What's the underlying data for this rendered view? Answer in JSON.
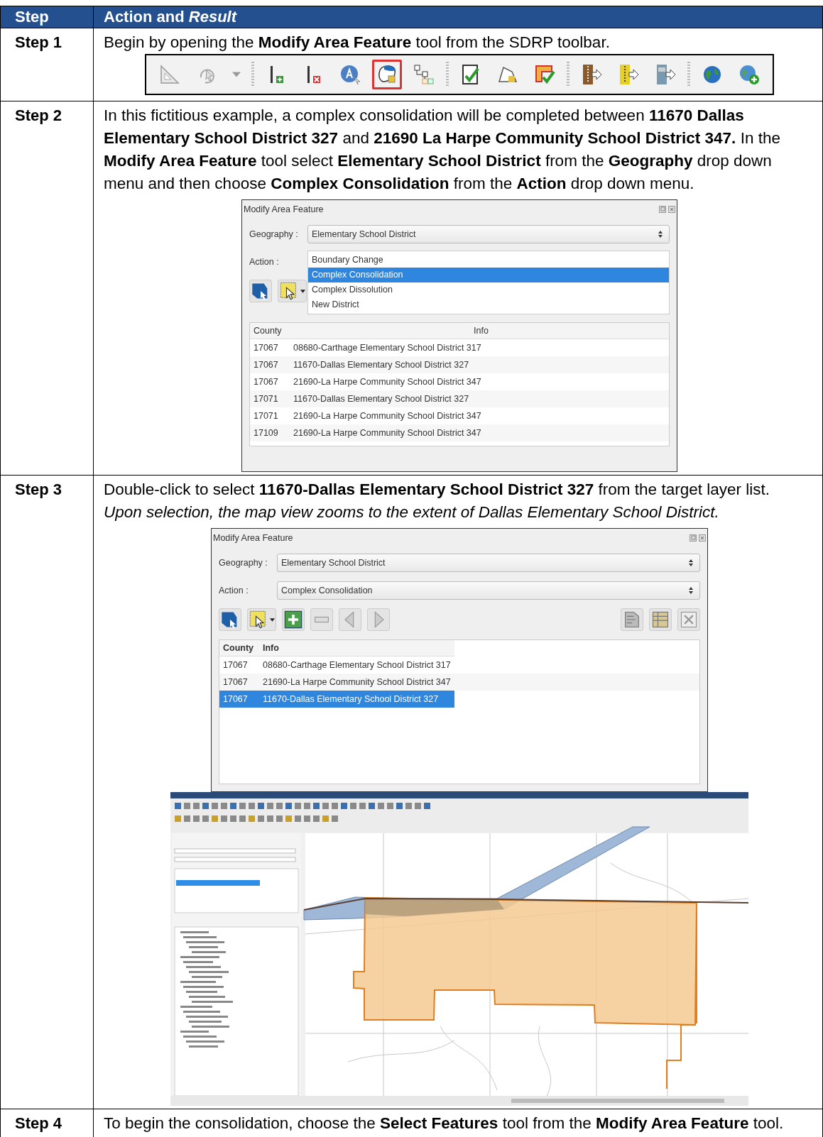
{
  "table": {
    "columns": [
      "Step",
      "Action and *Result*"
    ],
    "rows": [
      {
        "step": "Step 1",
        "text": "Begin by opening the **Modify Area Feature** tool from the SDRP toolbar.",
        "toolbar": {
          "groups": [
            [
              {
                "kind": "ruler",
                "highlighted": false
              },
              {
                "kind": "rotate",
                "highlighted": false
              },
              {
                "kind": "caret",
                "highlighted": false
              }
            ],
            [
              {
                "kind": "add-line",
                "highlighted": false
              },
              {
                "kind": "delete-line",
                "highlighted": false
              },
              {
                "kind": "label",
                "highlighted": false
              },
              {
                "kind": "area-edit",
                "highlighted": true
              },
              {
                "kind": "tree",
                "highlighted": false
              }
            ],
            [
              {
                "kind": "check-doc",
                "highlighted": false
              },
              {
                "kind": "polygon-edit",
                "highlighted": false
              },
              {
                "kind": "polygon-check",
                "highlighted": false
              }
            ],
            [
              {
                "kind": "export-zip",
                "highlighted": false
              },
              {
                "kind": "export-folder",
                "highlighted": false
              },
              {
                "kind": "export-map",
                "highlighted": false
              }
            ],
            [
              {
                "kind": "globe",
                "highlighted": false
              },
              {
                "kind": "globe-add",
                "highlighted": false
              }
            ]
          ]
        }
      },
      {
        "step": "Step 2",
        "text": "In this fictitious example, a complex consolidation will be completed between **11670 Dallas Elementary School District 327** and **21690 La Harpe Community School District 347.** In the **Modify Area Feature** tool select **Elementary School District** from the **Geography** drop down menu and then choose **Complex Consolidation** from the **Action** drop down menu.",
        "dialog": {
          "title": "Modify Area Feature",
          "geography_label": "Geography :",
          "geography_value": "Elementary School District",
          "action_label": "Action :",
          "action_options": [
            {
              "label": "Boundary Change",
              "selected": false
            },
            {
              "label": "Complex Consolidation",
              "selected": true
            },
            {
              "label": "Complex Dissolution",
              "selected": false
            },
            {
              "label": "New District",
              "selected": false
            }
          ],
          "tools": [
            {
              "kind": "select-polygon"
            },
            {
              "kind": "select-features"
            }
          ],
          "columns": [
            "County",
            "Info"
          ],
          "header_bold": false,
          "rows": [
            {
              "county": "17067",
              "info": "08680-Carthage Elementary School District 317",
              "selected": false
            },
            {
              "county": "17067",
              "info": "11670-Dallas Elementary School District 327",
              "selected": false
            },
            {
              "county": "17067",
              "info": "21690-La Harpe Community School District 347",
              "selected": false
            },
            {
              "county": "17071",
              "info": "11670-Dallas Elementary School District 327",
              "selected": false
            },
            {
              "county": "17071",
              "info": "21690-La Harpe Community School District 347",
              "selected": false
            },
            {
              "county": "17109",
              "info": "21690-La Harpe Community School District 347",
              "selected": false
            }
          ]
        }
      },
      {
        "step": "Step 3",
        "text": "Double-click to select **11670-Dallas Elementary School District 327** from the target layer list.",
        "note": "Upon selection, the map view zooms to the extent of Dallas Elementary School District.",
        "dialog": {
          "title": "Modify Area Feature",
          "geography_label": "Geography :",
          "geography_value": "Elementary School District",
          "action_label": "Action :",
          "action_value": "Complex Consolidation",
          "tools": [
            {
              "kind": "select-polygon"
            },
            {
              "kind": "select-features"
            },
            {
              "kind": "add"
            },
            {
              "kind": "remove"
            },
            {
              "kind": "previous"
            },
            {
              "kind": "next"
            }
          ],
          "right_tools": [
            {
              "kind": "map"
            },
            {
              "kind": "table"
            },
            {
              "kind": "close"
            }
          ],
          "columns": [
            "County",
            "Info"
          ],
          "header_bold": true,
          "rows": [
            {
              "county": "17067",
              "info": "08680-Carthage Elementary School District 317",
              "selected": false
            },
            {
              "county": "17067",
              "info": "21690-La Harpe Community School District 347",
              "selected": false
            },
            {
              "county": "17067",
              "info": "11670-Dallas Elementary School District 327",
              "selected": true
            }
          ]
        },
        "figure": {
          "kind": "map-window"
        }
      },
      {
        "step": "Step 4",
        "text": "To begin the consolidation, choose the **Select Features** tool from the **Modify Area Feature** tool."
      }
    ]
  }
}
